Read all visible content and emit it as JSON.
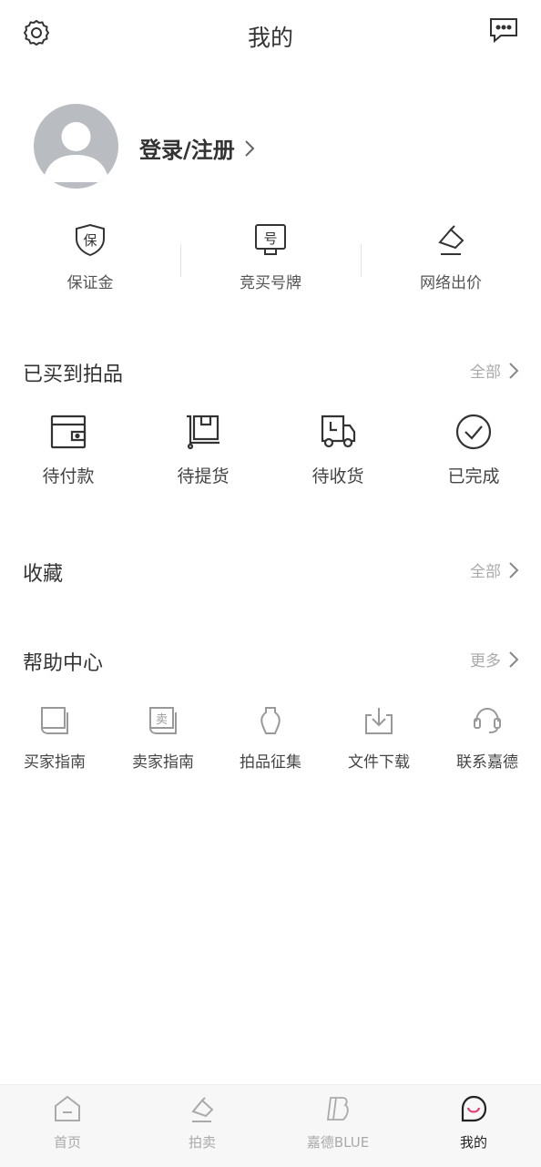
{
  "header": {
    "title": "我的",
    "settings_icon": "gear-icon",
    "message_icon": "message-icon"
  },
  "profile": {
    "login_label": "登录/注册",
    "avatar_icon": "default-avatar"
  },
  "quick_actions": [
    {
      "label": "保证金",
      "icon": "shield-deposit-icon",
      "glyph": "保"
    },
    {
      "label": "竞买号牌",
      "icon": "bid-paddle-icon",
      "glyph": "号"
    },
    {
      "label": "网络出价",
      "icon": "gavel-icon"
    }
  ],
  "purchased": {
    "title": "已买到拍品",
    "more_label": "全部",
    "items": [
      {
        "label": "待付款",
        "icon": "wallet-icon"
      },
      {
        "label": "待提货",
        "icon": "pickup-cart-icon"
      },
      {
        "label": "待收货",
        "icon": "delivery-truck-icon"
      },
      {
        "label": "已完成",
        "icon": "check-circle-icon"
      }
    ]
  },
  "favorites": {
    "title": "收藏",
    "more_label": "全部"
  },
  "help": {
    "title": "帮助中心",
    "more_label": "更多",
    "items": [
      {
        "label": "买家指南",
        "icon": "book-icon"
      },
      {
        "label": "卖家指南",
        "icon": "seller-book-icon",
        "glyph": "卖"
      },
      {
        "label": "拍品征集",
        "icon": "vase-icon"
      },
      {
        "label": "文件下载",
        "icon": "download-icon"
      },
      {
        "label": "联系嘉德",
        "icon": "headset-icon"
      }
    ]
  },
  "tabbar": {
    "tabs": [
      {
        "label": "首页",
        "icon": "home-icon",
        "active": false
      },
      {
        "label": "拍卖",
        "icon": "auction-icon",
        "active": false
      },
      {
        "label": "嘉德BLUE",
        "icon": "blue-logo-icon",
        "active": false
      },
      {
        "label": "我的",
        "icon": "profile-icon",
        "active": true
      }
    ]
  },
  "colors": {
    "text": "#333333",
    "muted": "#aaaaaa",
    "avatar_bg": "#b9bcc1",
    "tabbar_bg": "#f7f7f7"
  }
}
